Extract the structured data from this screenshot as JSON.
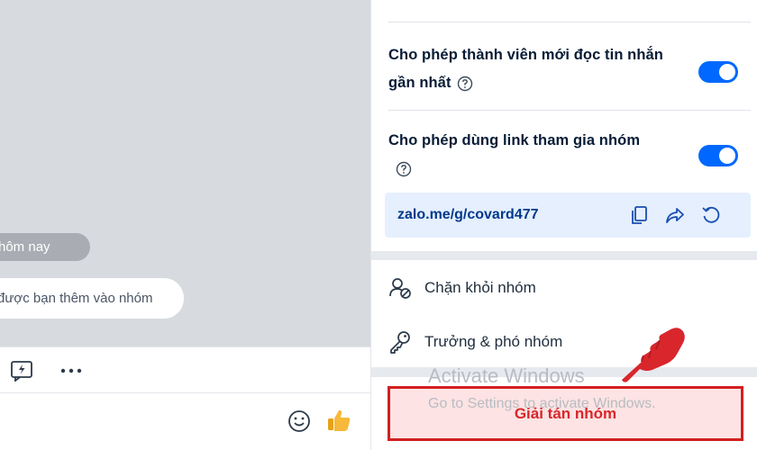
{
  "chat": {
    "date_pill": "hôm nay",
    "system_message": "được bạn thêm vào nhóm",
    "toolbar": {
      "quick_icon": "quick-message-icon",
      "more_icon": "more-icon"
    },
    "input": {
      "emoji_icon": "emoji-icon",
      "like_icon": "thumbs-up-icon"
    }
  },
  "settings": {
    "recent_messages": {
      "label_line1": "Cho phép thành viên mới đọc tin nhắn",
      "label_line2": "gần nhất",
      "enabled": true
    },
    "join_link": {
      "label": "Cho phép dùng link tham gia nhóm",
      "enabled": true,
      "url": "zalo.me/g/covard477"
    },
    "menu": [
      {
        "label": "Chặn khỏi nhóm",
        "icon": "block-user-icon"
      },
      {
        "label": "Trưởng & phó nhóm",
        "icon": "key-icon"
      }
    ],
    "disband_label": "Giải tán nhóm"
  },
  "watermark": {
    "line1": "Activate Windows",
    "line2": "Go to Settings to activate Windows."
  },
  "colors": {
    "accent_blue": "#0068ff",
    "danger_red": "#d21f1f",
    "link_bg": "#e5effe"
  }
}
